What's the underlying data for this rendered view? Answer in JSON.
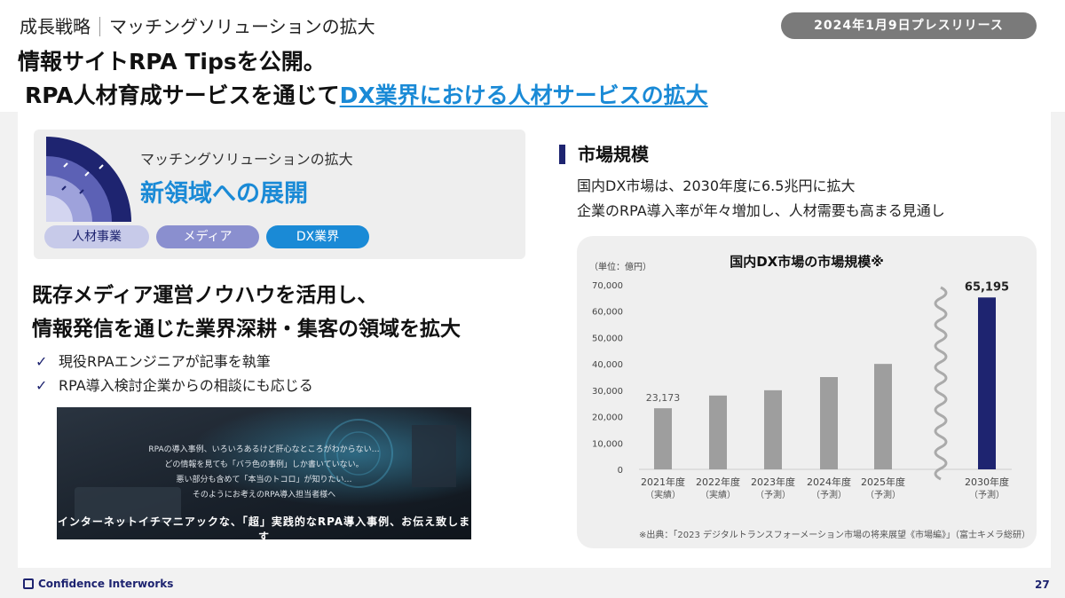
{
  "header": {
    "section": "成長戦略",
    "subsection": "マッチングソリューションの拡大",
    "press_date": "2024年1月9日プレスリリース",
    "title_line1": "情報サイトRPA Tipsを公開。",
    "title_line2_prefix": "RPA人材育成サービスを通じて",
    "title_line2_highlight": "DX業界における人材サービスの拡大"
  },
  "banner": {
    "subtitle": "マッチングソリューションの拡大",
    "title": "新領域への展開",
    "pills": [
      "人材事業",
      "メディア",
      "DX業界"
    ]
  },
  "lead": {
    "line1": "既存メディア運営ノウハウを活用し、",
    "line2": "情報発信を通じた業界深耕・集客の領域を拡大"
  },
  "checklist": [
    "現役RPAエンジニアが記事を執筆",
    "RPA導入検討企業からの相談にも応じる"
  ],
  "photo": {
    "lines": [
      "RPAの導入事例、いろいろあるけど肝心なところがわからない…",
      "どの情報を見ても「バラ色の事例」しか書いていない。",
      "悪い部分も含めて「本当のトコロ」が知りたい…",
      "そのようにお考えのRPA導入担当者様へ"
    ],
    "headline": "インターネットイチマニアックな、「超」実践的なRPA導入事例、お伝え致します"
  },
  "market": {
    "heading": "市場規模",
    "desc_line1": "国内DX市場は、2030年度に6.5兆円に拡大",
    "desc_line2": "企業のRPA導入率が年々増加し、人材需要も高まる見通し"
  },
  "chart_data": {
    "type": "bar",
    "title": "国内DX市場の市場規模※",
    "unit_label": "（単位：億円）",
    "categories": [
      "2021年度",
      "2022年度",
      "2023年度",
      "2024年度",
      "2025年度",
      "2030年度"
    ],
    "category_notes": [
      "（実績）",
      "（実績）",
      "（予測）",
      "（予測）",
      "（予測）",
      "（予測）"
    ],
    "values": [
      23173,
      28000,
      30000,
      35000,
      40000,
      65195
    ],
    "data_labels": [
      "23,173",
      "",
      "",
      "",
      "",
      "65,195"
    ],
    "ylim": [
      0,
      70000
    ],
    "yticks": [
      "0",
      "10,000",
      "20,000",
      "30,000",
      "40,000",
      "50,000",
      "60,000",
      "70,000"
    ],
    "ytick_values": [
      0,
      10000,
      20000,
      30000,
      40000,
      50000,
      60000,
      70000
    ],
    "colors": [
      "#9e9e9e",
      "#9e9e9e",
      "#9e9e9e",
      "#9e9e9e",
      "#9e9e9e",
      "#1e2470"
    ],
    "axis_break": true,
    "source": "※出典：「2023 デジタルトランスフォーメーション市場の将来展望《市場編》」（富士キメラ総研）"
  },
  "footer": {
    "company": "Confidence Interworks",
    "page": "27"
  }
}
